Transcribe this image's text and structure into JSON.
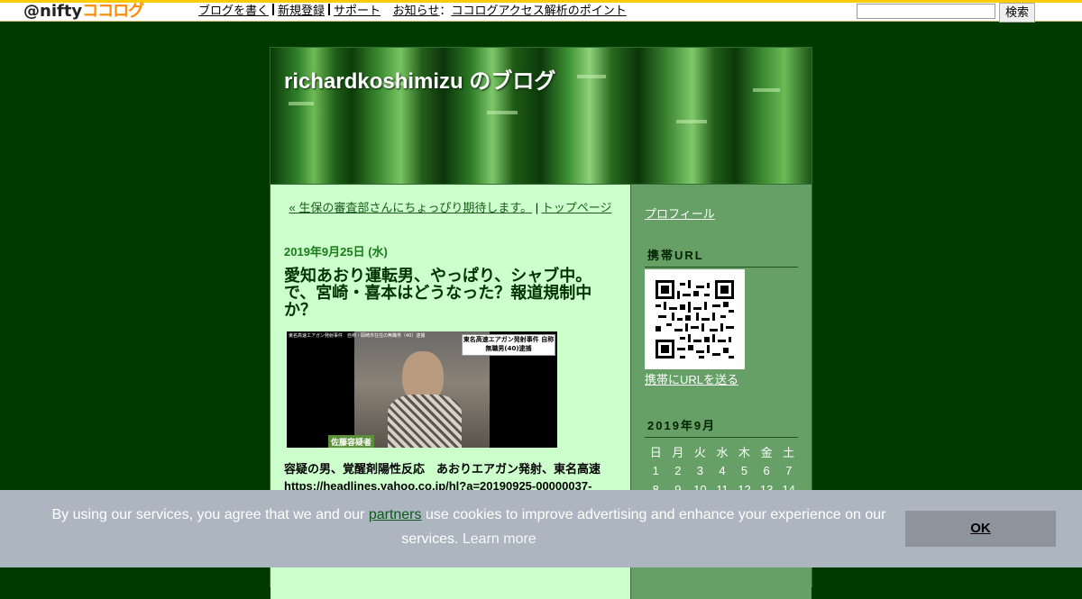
{
  "header": {
    "logo_prefix": "@nifty",
    "logo_brand": "ココログ",
    "nav": {
      "write_blog": "ブログを書く",
      "register": "新規登録",
      "support": "サポート",
      "notice_label": "お知らせ",
      "notice_colon": "：",
      "notice_link": "ココログアクセス解析のポイント"
    },
    "search": {
      "value": "",
      "button_label": "検索"
    },
    "accent_color": "#ffcc00"
  },
  "blog": {
    "title": "richardkoshimizu のブログ",
    "page_bg_color": "#003a00",
    "main_bg_color": "#ccffcc",
    "sidebar_bg_color": "#66a066"
  },
  "pagenav": {
    "prev_link": "« 生保の審査部さんにちょっぴり期待します。",
    "separator": "|",
    "top_link": "トップページ"
  },
  "post": {
    "date": "2019年9月25日 (水)",
    "title": "愛知あおり運転男、やっぱり、シャブ中。で、宮崎・喜本はどうなった？報道規制中か？",
    "image": {
      "caption_top": "東名高速エアガン発射事件　自称・岡崎市在住の無職男（40）逮捕",
      "caption_box": "東名高速エアガン発射事件 自称 無職男(40)逮捕",
      "caption_bottom": "佐藤容疑者"
    },
    "body_lines": [
      "容疑の男、覚醒剤陽性反応　あおりエアガン発射、東名高速",
      "https://headlines.yahoo.co.jp/hl?a=20190925-00000037-"
    ]
  },
  "sidebar": {
    "profile_link": "プロフィール",
    "mobile_title": "携帯URL",
    "send_url_link": "携帯にURLを送る",
    "calendar": {
      "title": "2019年9月",
      "weekdays": [
        "日",
        "月",
        "火",
        "水",
        "木",
        "金",
        "土"
      ],
      "rows": [
        [
          "1",
          "2",
          "3",
          "4",
          "5",
          "6",
          "7"
        ],
        [
          "8",
          "9",
          "10",
          "11",
          "12",
          "13",
          "14"
        ]
      ]
    }
  },
  "cookie": {
    "text_before": "By using our services, you agree that we and our ",
    "partners_link": "partners",
    "text_after": " use cookies to improve advertising and enhance your experience on our services. ",
    "learn_more": "Learn more",
    "ok_button": "OK"
  }
}
